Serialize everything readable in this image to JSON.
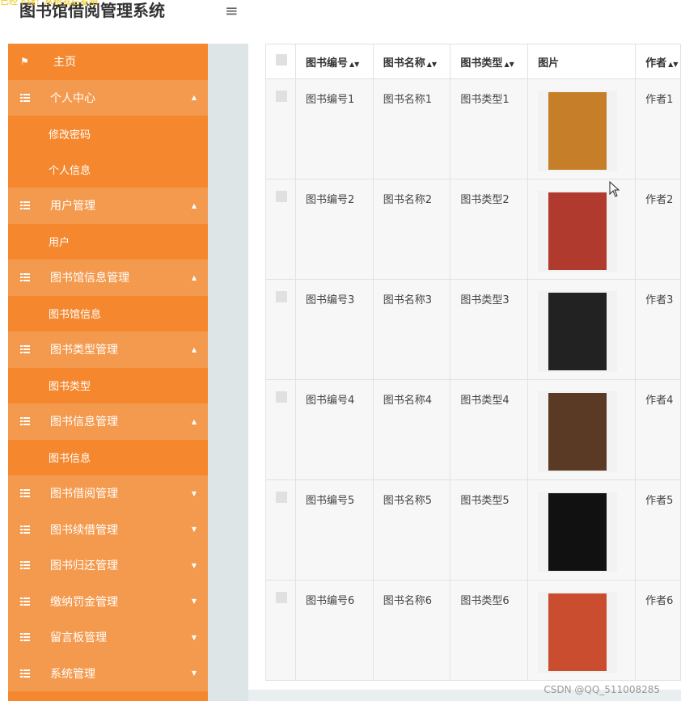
{
  "overlay": "已经下线！从帮我后看吧",
  "app_title": "图书馆借阅管理系统",
  "sidebar": {
    "items": [
      {
        "label": "主页",
        "type": "home",
        "icon": "flag-icon"
      },
      {
        "label": "个人中心",
        "type": "parent",
        "caret": "▲"
      },
      {
        "label": "修改密码",
        "type": "child"
      },
      {
        "label": "个人信息",
        "type": "child"
      },
      {
        "label": "用户管理",
        "type": "parent",
        "caret": "▲"
      },
      {
        "label": "用户",
        "type": "child"
      },
      {
        "label": "图书馆信息管理",
        "type": "parent",
        "caret": "▲"
      },
      {
        "label": "图书馆信息",
        "type": "child"
      },
      {
        "label": "图书类型管理",
        "type": "parent",
        "caret": "▲"
      },
      {
        "label": "图书类型",
        "type": "child"
      },
      {
        "label": "图书信息管理",
        "type": "parent",
        "caret": "▲"
      },
      {
        "label": "图书信息",
        "type": "child"
      },
      {
        "label": "图书借阅管理",
        "type": "parent",
        "caret": "▼"
      },
      {
        "label": "图书续借管理",
        "type": "parent",
        "caret": "▼"
      },
      {
        "label": "图书归还管理",
        "type": "parent",
        "caret": "▼"
      },
      {
        "label": "缴纳罚金管理",
        "type": "parent",
        "caret": "▼"
      },
      {
        "label": "留言板管理",
        "type": "parent",
        "caret": "▼"
      },
      {
        "label": "系统管理",
        "type": "parent",
        "caret": "▼"
      }
    ]
  },
  "table": {
    "headers": [
      "图书编号",
      "图书名称",
      "图书类型",
      "图片",
      "作者"
    ],
    "rows": [
      {
        "code": "图书编号1",
        "name": "图书名称1",
        "type": "图书类型1",
        "author": "作者1",
        "cover": "#c67f28"
      },
      {
        "code": "图书编号2",
        "name": "图书名称2",
        "type": "图书类型2",
        "author": "作者2",
        "cover": "#b13a2e"
      },
      {
        "code": "图书编号3",
        "name": "图书名称3",
        "type": "图书类型3",
        "author": "作者3",
        "cover": "#222222"
      },
      {
        "code": "图书编号4",
        "name": "图书名称4",
        "type": "图书类型4",
        "author": "作者4",
        "cover": "#5a3a25"
      },
      {
        "code": "图书编号5",
        "name": "图书名称5",
        "type": "图书类型5",
        "author": "作者5",
        "cover": "#111111"
      },
      {
        "code": "图书编号6",
        "name": "图书名称6",
        "type": "图书类型6",
        "author": "作者6",
        "cover": "#c94d2e"
      }
    ]
  },
  "watermark": "CSDN @QQ_511008285",
  "colors": {
    "sidebar": "#f5882f",
    "parent_item": "#f49a4e"
  }
}
